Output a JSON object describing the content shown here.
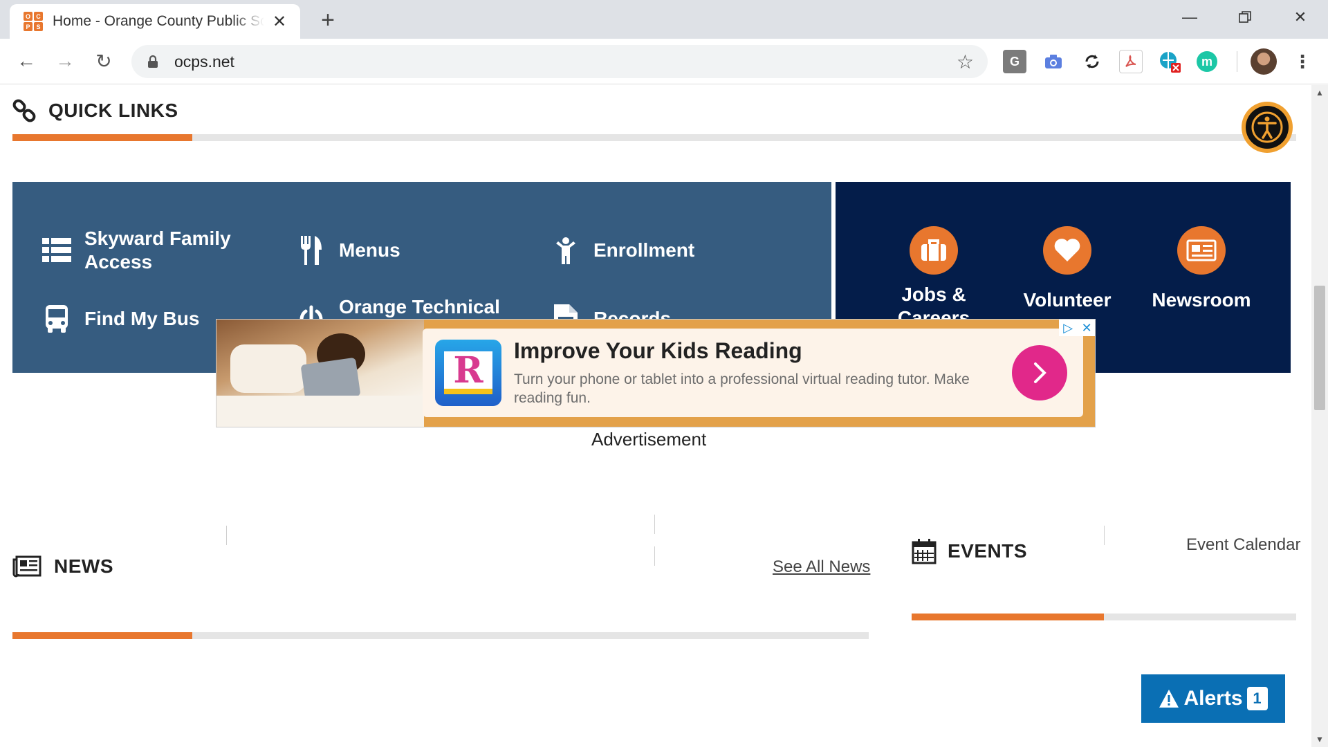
{
  "browser": {
    "tab_title": "Home - Orange County Public Schools",
    "favicon_letters": [
      "O",
      "C",
      "P",
      "S"
    ],
    "url": "ocps.net",
    "window_controls": [
      "minimize-icon",
      "restore-icon",
      "close-icon"
    ],
    "extensions": [
      {
        "name": "grammarly-icon",
        "glyph": "G",
        "color": "#7b7b7b"
      },
      {
        "name": "screenshot-camera-icon",
        "glyph": "",
        "color": "#5b7fe0"
      },
      {
        "name": "sync-icon",
        "glyph": "",
        "color": "#222222"
      },
      {
        "name": "pdf-icon",
        "glyph": "",
        "color": "#d9534f"
      },
      {
        "name": "extension-globe-icon",
        "glyph": "",
        "color": "#1aa3c7"
      },
      {
        "name": "mote-icon",
        "glyph": "m",
        "color": "#1cc7a6"
      }
    ]
  },
  "quick_links": {
    "title": "QUICK LINKS",
    "progress_fraction": 0.14,
    "items": [
      {
        "label": "Skyward Family Access",
        "icon": "list-icon"
      },
      {
        "label": "Menus",
        "icon": "utensils-icon"
      },
      {
        "label": "Enrollment",
        "icon": "child-icon"
      },
      {
        "label": "Find My Bus",
        "icon": "bus-icon"
      },
      {
        "label": "Orange Technical College",
        "icon": "power-icon"
      },
      {
        "label": "Records",
        "icon": "document-icon"
      }
    ],
    "featured": [
      {
        "label": "Jobs & Careers",
        "icon": "briefcase-icon"
      },
      {
        "label": "Volunteer",
        "icon": "heart-icon"
      },
      {
        "label": "Newsroom",
        "icon": "newspaper-icon"
      }
    ]
  },
  "ad": {
    "title": "Improve Your Kids Reading",
    "description": "Turn your phone or tablet into a professional virtual reading tutor. Make reading fun.",
    "logo_letter": "R",
    "caption": "Advertisement"
  },
  "news": {
    "title": "NEWS",
    "see_all": "See All News",
    "progress_fraction": 0.21
  },
  "events": {
    "title": "EVENTS",
    "calendar_link": "Event Calendar",
    "progress_fraction": 0.5
  },
  "alerts": {
    "label": "Alerts",
    "count": "1"
  },
  "colors": {
    "accent_orange": "#e8772e",
    "panel_blue": "#365c80",
    "panel_navy": "#041d4a",
    "alerts_blue": "#0a6fb4",
    "ad_pink": "#e1288a"
  }
}
